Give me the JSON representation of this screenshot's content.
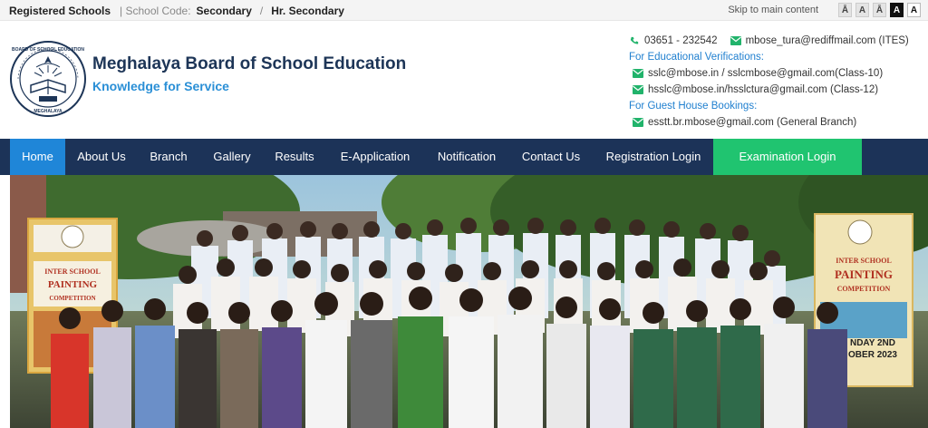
{
  "topbar": {
    "registered_schools": "Registered Schools",
    "school_code_label": "| School Code:",
    "school_code_value": "Secondary",
    "divider": "/",
    "hr_secondary": "Hr. Secondary",
    "skip_link": "Skip to main content",
    "font_buttons": [
      "Ā",
      "A",
      "Ā",
      "A",
      "A"
    ]
  },
  "header": {
    "title": "Meghalaya Board of School Education",
    "tagline": "Knowledge for Service",
    "logo_text": "BOARD OF SCHOOL EDUCATION MEGHALAYA"
  },
  "contacts": {
    "phone": "03651 - 232542",
    "email_main": "mbose_tura@rediffmail.com (ITES)",
    "verification_heading": "For Educational Verifications:",
    "email_sslc": "sslc@mbose.in / sslcmbose@gmail.com(Class-10)",
    "email_hsslc": "hsslc@mbose.in/hsslctura@gmail.com (Class-12)",
    "guest_heading": "For Guest House Bookings:",
    "email_guest": "esstt.br.mbose@gmail.com (General Branch)"
  },
  "nav": {
    "items": [
      "Home",
      "About Us",
      "Branch",
      "Gallery",
      "Results",
      "E-Application",
      "Notification",
      "Contact Us",
      "Registration Login",
      "Examination Login"
    ],
    "active": "Home"
  },
  "banner": {
    "poster_left": [
      "INTER SCHOOL",
      "PAINTING",
      "COMPETITION"
    ],
    "poster_right": [
      "INTER SCHOOL",
      "PAINTING",
      "COMPETITION",
      "NDAY 2ND",
      "OBER 2023"
    ]
  },
  "colors": {
    "nav_bg": "#1c3358",
    "active_tab": "#1f86d8",
    "exam_login": "#20c470",
    "title": "#1d3557",
    "accent": "#2a8fd6",
    "contact_icon": "#21b36b"
  }
}
